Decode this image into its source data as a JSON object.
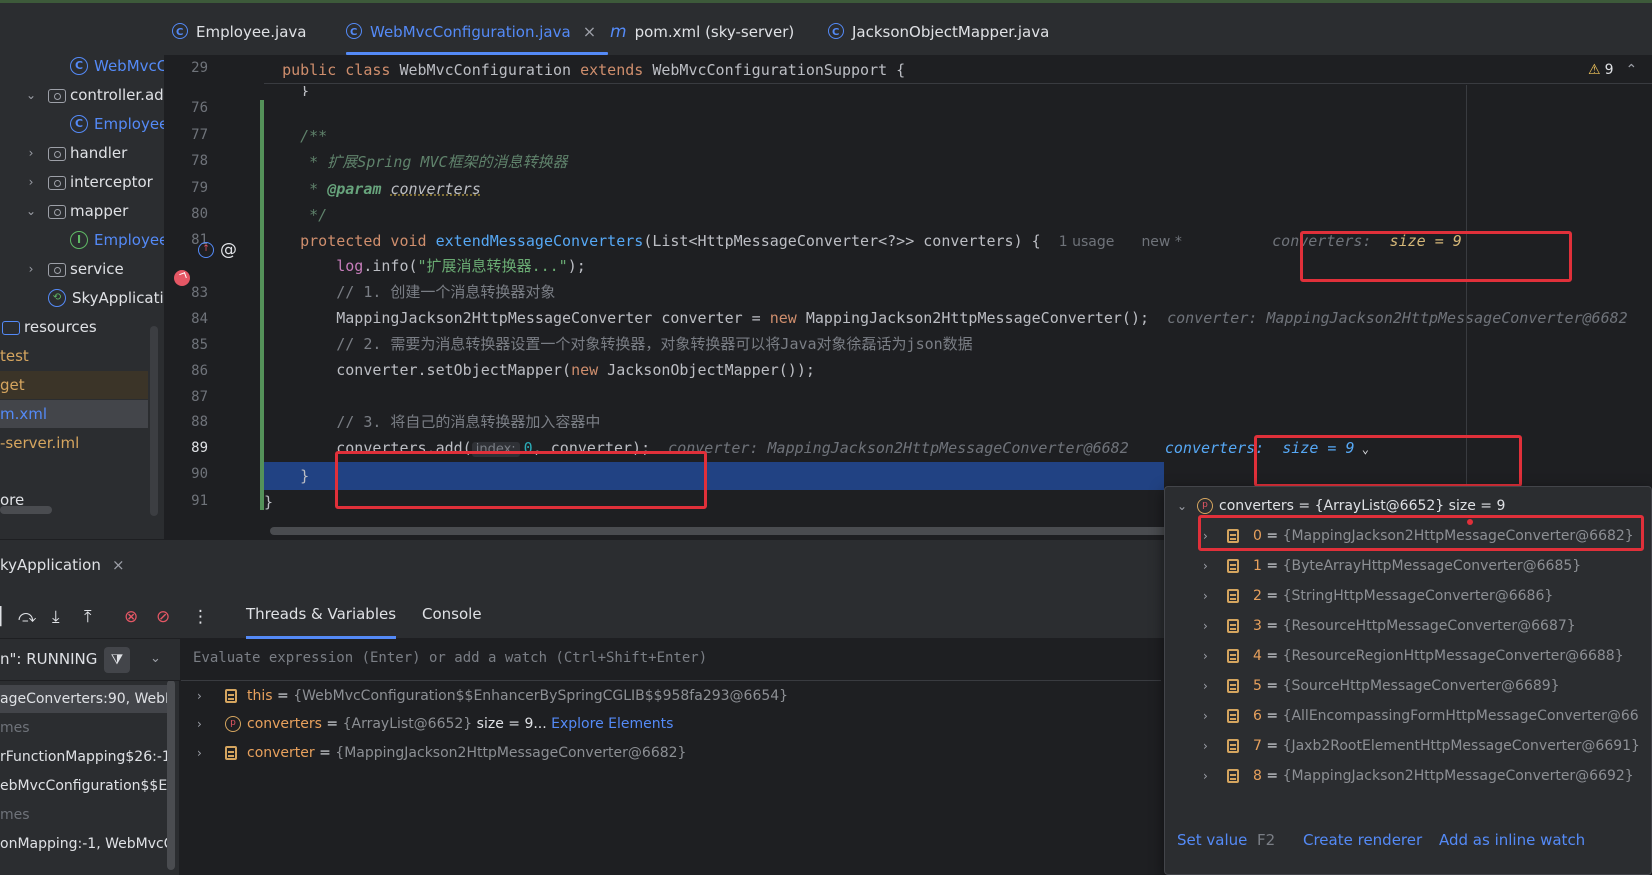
{
  "tree": {
    "items": [
      {
        "label": "WebMvcC",
        "icon": "class-icon",
        "color": "blue"
      },
      {
        "label": "controller.ad",
        "icon": "folder-icon",
        "chevron": "down"
      },
      {
        "label": "Employee",
        "icon": "class-icon",
        "color": "blue"
      },
      {
        "label": "handler",
        "icon": "folder-icon",
        "chevron": "right"
      },
      {
        "label": "interceptor",
        "icon": "folder-icon",
        "chevron": "right"
      },
      {
        "label": "mapper",
        "icon": "folder-icon",
        "chevron": "down"
      },
      {
        "label": "Employee",
        "icon": "interface-icon",
        "color": "blue"
      },
      {
        "label": "service",
        "icon": "folder-icon",
        "chevron": "right"
      },
      {
        "label": "SkyApplicati",
        "icon": "spring-icon"
      },
      {
        "label": "resources",
        "icon": "resources-folder-icon"
      },
      {
        "label": "test"
      },
      {
        "label": "get"
      },
      {
        "label": "m.xml"
      },
      {
        "label": "-server.iml"
      },
      {
        "label": "ore"
      }
    ]
  },
  "tabs": [
    {
      "label": "Employee.java",
      "icon": "class-icon"
    },
    {
      "label": "WebMvcConfiguration.java",
      "icon": "class-icon",
      "active": true,
      "close": "×"
    },
    {
      "label": "pom.xml (sky-server)",
      "icon": "maven-icon",
      "glyph": "m"
    },
    {
      "label": "JacksonObjectMapper.java",
      "icon": "class-icon"
    }
  ],
  "editor": {
    "warnings": "9",
    "line_numbers": [
      "29",
      "76",
      "77",
      "78",
      "79",
      "80",
      "81",
      "82",
      "83",
      "84",
      "85",
      "86",
      "87",
      "88",
      "89",
      "90",
      "91"
    ],
    "sticky": {
      "kw1": "public",
      "kw2": "class",
      "name": "WebMvcConfiguration",
      "kw3": "extends",
      "rest": "WebMvcConfigurationSupport {"
    },
    "l76": "}",
    "l77": "/**",
    "l78": " * 扩展Spring MVC框架的消息转换器",
    "l79_pre": " * ",
    "l79_tag": "@param",
    "l79_ref": "converters",
    "l80": " */",
    "l81": {
      "kw": "protected void",
      "fn": "extendMessageConverters",
      "rest": "(List<HttpMessageConverter<?>> converters) {",
      "usage": "1 usage",
      "new": "new *",
      "dbg_name": "converters:",
      "dbg_val": "size = 9"
    },
    "l82": {
      "field": "log",
      "mid": ".info(",
      "str": "\"扩展消息转换器...\"",
      "end": ");"
    },
    "l83": "// 1. 创建一个消息转换器对象",
    "l84": {
      "type": "MappingJackson2HttpMessageConverter converter = ",
      "kw": "new",
      "rest": " MappingJackson2HttpMessageConverter();",
      "dbg": "converter: MappingJackson2HttpMessageConverter@6682"
    },
    "l85": "// 2. 需要为消息转换器设置一个对象转换器，对象转换器可以将Java对象徐磊话为json数据",
    "l86": {
      "pre": "converter.setObjectMapper(",
      "kw": "new",
      "rest": " JacksonObjectMapper());"
    },
    "l88": "// 3. 将自己的消息转换器加入容器中",
    "l89": {
      "pre": "converters.add(",
      "hint": "index:",
      "num": "0",
      "rest": ", converter);",
      "dbg": "converter: MappingJackson2HttpMessageConverter@6682",
      "dbg2_name": "converters:",
      "dbg2_val": "size = 9"
    },
    "l90": "}",
    "l91": "}"
  },
  "debug": {
    "run_tab": "kyApplication",
    "run_close": "×",
    "tabs": [
      "Threads & Variables",
      "Console"
    ],
    "thread": "n\": RUNNING",
    "eval_placeholder": "Evaluate expression (Enter) or add a watch (Ctrl+Shift+Enter)",
    "frames": [
      {
        "label": "ageConverters:90, WebM",
        "selected": true
      },
      {
        "label": "mes",
        "gray": true
      },
      {
        "label": "rFunctionMapping$26:-1"
      },
      {
        "label": "ebMvcConfiguration$$E"
      },
      {
        "label": "mes",
        "gray": true
      },
      {
        "label": "onMapping:-1, WebMvcC"
      }
    ],
    "vars": [
      {
        "name": "this",
        "eq": " = ",
        "val": "{WebMvcConfiguration$$EnhancerBySpringCGLIB$$958fa293@6654}"
      },
      {
        "name": "converters",
        "eq": " = ",
        "val": "{ArrayList@6652}",
        "size": " size = 9...",
        "link": " Explore Elements"
      },
      {
        "name": "converter",
        "eq": " = ",
        "val": "{MappingJackson2HttpMessageConverter@6682}"
      }
    ]
  },
  "popup": {
    "root": {
      "name": "converters",
      "eq": " = ",
      "val": "{ArrayList@6652}",
      "size": " size = 9"
    },
    "items": [
      {
        "idx": "0",
        "val": "{MappingJackson2HttpMessageConverter@6682}"
      },
      {
        "idx": "1",
        "val": "{ByteArrayHttpMessageConverter@6685}"
      },
      {
        "idx": "2",
        "val": "{StringHttpMessageConverter@6686}"
      },
      {
        "idx": "3",
        "val": "{ResourceHttpMessageConverter@6687}"
      },
      {
        "idx": "4",
        "val": "{ResourceRegionHttpMessageConverter@6688}"
      },
      {
        "idx": "5",
        "val": "{SourceHttpMessageConverter@6689}"
      },
      {
        "idx": "6",
        "val": "{AllEncompassingFormHttpMessageConverter@66"
      },
      {
        "idx": "7",
        "val": "{Jaxb2RootElementHttpMessageConverter@6691}"
      },
      {
        "idx": "8",
        "val": "{MappingJackson2HttpMessageConverter@6692}"
      }
    ],
    "footer": {
      "set_value": "Set value",
      "shortcut": "F2",
      "create_renderer": "Create renderer",
      "add_watch": "Add as inline watch"
    }
  }
}
